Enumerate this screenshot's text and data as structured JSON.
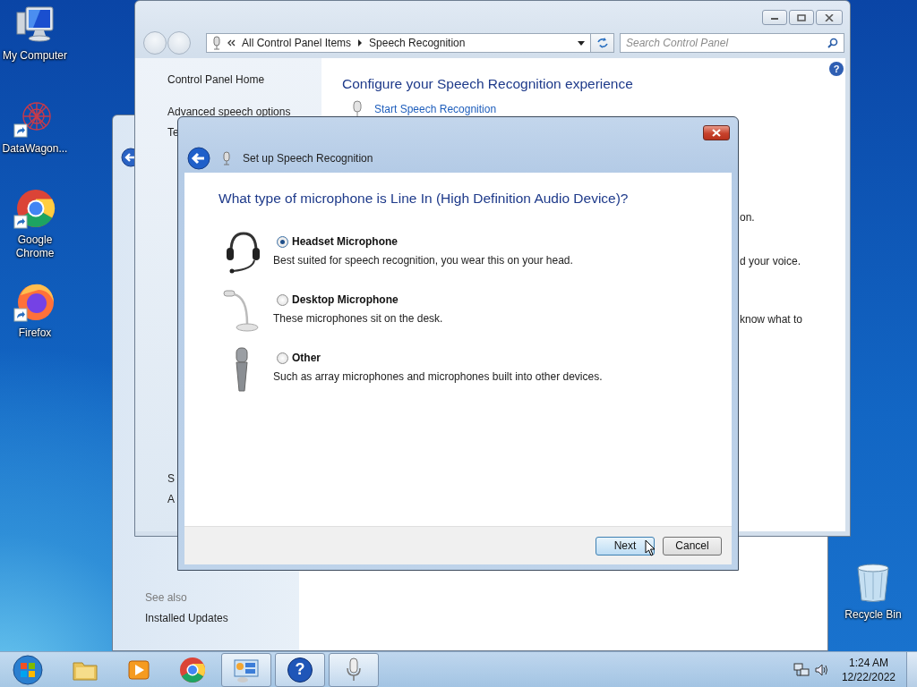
{
  "desktop_icons": [
    {
      "kind": "computer",
      "label": "My Computer",
      "shortcut": false
    },
    {
      "kind": "datawagon",
      "label": "DataWagon...",
      "shortcut": true
    },
    {
      "kind": "chrome",
      "label": "Google Chrome",
      "shortcut": true
    },
    {
      "kind": "firefox",
      "label": "Firefox",
      "shortcut": true
    }
  ],
  "recycle_bin": {
    "label": "Recycle Bin"
  },
  "background_window": {
    "see_also": "See also",
    "links": [
      "Installed Updates"
    ]
  },
  "control_panel": {
    "crumbs": [
      "All Control Panel Items",
      "Speech Recognition"
    ],
    "search": {
      "placeholder": "Search Control Panel"
    },
    "help_glyph": "?",
    "sidebar": {
      "items": [
        "Control Panel Home",
        "Advanced speech options",
        "Te"
      ],
      "lower": [
        "S",
        "A"
      ]
    },
    "heading": "Configure your Speech Recognition experience",
    "links": [
      "Start Speech Recognition"
    ],
    "partial_texts": [
      "on.",
      "d your voice.",
      "know what to"
    ]
  },
  "dialog": {
    "title": "Set up Speech Recognition",
    "question": "What type of microphone is Line In (High Definition Audio Device)?",
    "options": [
      {
        "kind": "headset",
        "label": "Headset Microphone",
        "description": "Best suited for speech recognition, you wear this on your head.",
        "selected": true
      },
      {
        "kind": "desktop",
        "label": "Desktop Microphone",
        "description": "These microphones sit on the desk.",
        "selected": false
      },
      {
        "kind": "handheld",
        "label": "Other",
        "description": "Such as array microphones and microphones built into other devices.",
        "selected": false
      }
    ],
    "buttons": [
      {
        "label": "Next",
        "default": true
      },
      {
        "label": "Cancel",
        "default": false
      }
    ]
  },
  "taskbar": {
    "items": [
      {
        "kind": "explorer",
        "active": false
      },
      {
        "kind": "media",
        "active": false
      },
      {
        "kind": "chrome",
        "active": false
      },
      {
        "kind": "control_panel",
        "active": true
      },
      {
        "kind": "help",
        "active": true,
        "glyph": "?"
      },
      {
        "kind": "microphone",
        "active": true
      }
    ],
    "time": "1:24 AM",
    "date": "12/22/2022"
  }
}
